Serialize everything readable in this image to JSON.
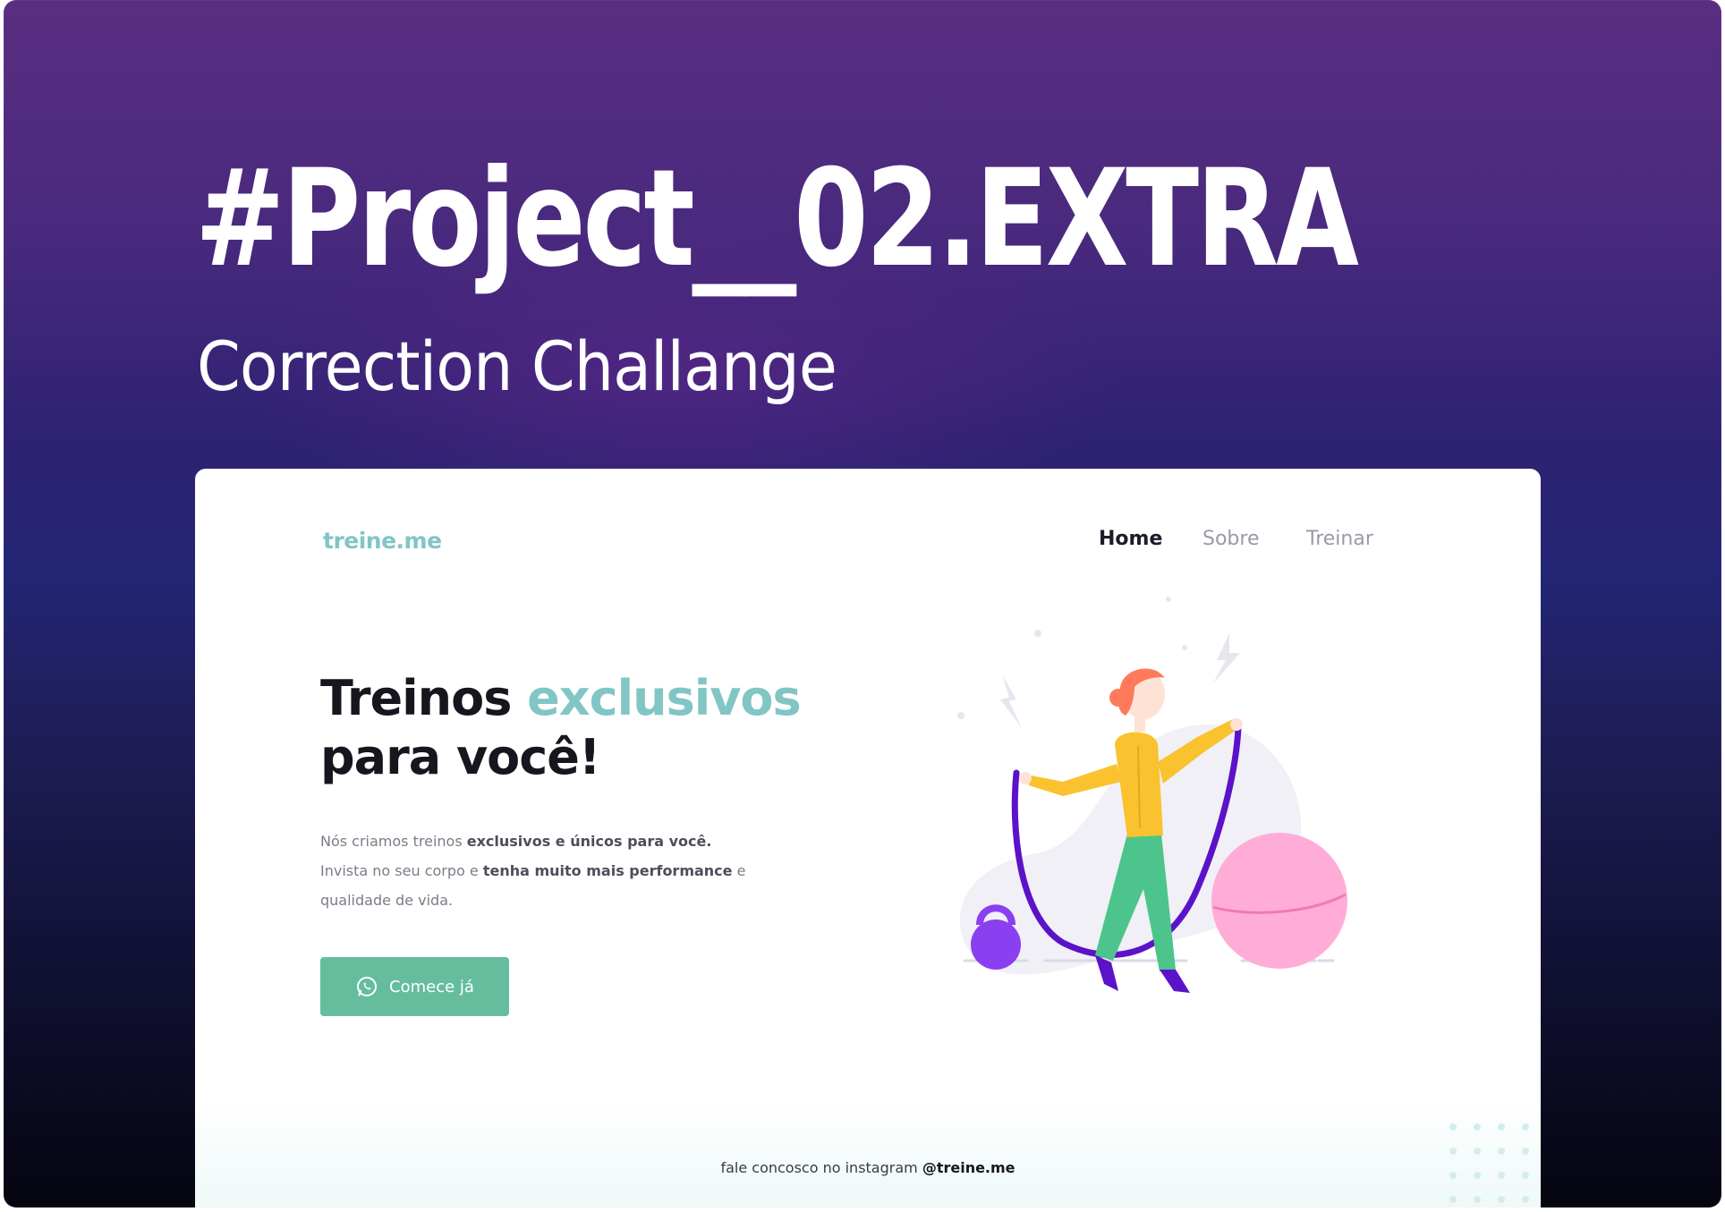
{
  "poster": {
    "title": "#Project__02.EXTRA",
    "subtitle": "Correction Challange"
  },
  "site": {
    "logo": "treine.me",
    "nav": [
      {
        "label": "Home",
        "active": true
      },
      {
        "label": "Sobre",
        "active": false
      },
      {
        "label": "Treinar",
        "active": false
      }
    ],
    "hero": {
      "title_prefix": "Treinos ",
      "title_accent": "exclusivos",
      "title_line2": "para você!",
      "text": [
        {
          "plain": "Nós criamos treinos ",
          "bold": "exclusivos e únicos para você.",
          "tail": ""
        },
        {
          "plain": "Invista no seu corpo e ",
          "bold": "tenha muito mais performance",
          "tail": " e"
        },
        {
          "plain": "qualidade de vida.",
          "bold": "",
          "tail": ""
        }
      ],
      "cta_label": "Comece já",
      "cta_icon": "whatsapp-icon"
    },
    "footer": {
      "text": "fale concosco no instagram ",
      "handle": "@treine.me"
    }
  },
  "colors": {
    "accent": "#82c5c5",
    "button": "#66bd9e",
    "rope": "#5b12c8",
    "shirt": "#f9c22e",
    "pants": "#4dc48c",
    "ball": "#ffadd6",
    "kettlebell": "#8a3ff0"
  }
}
